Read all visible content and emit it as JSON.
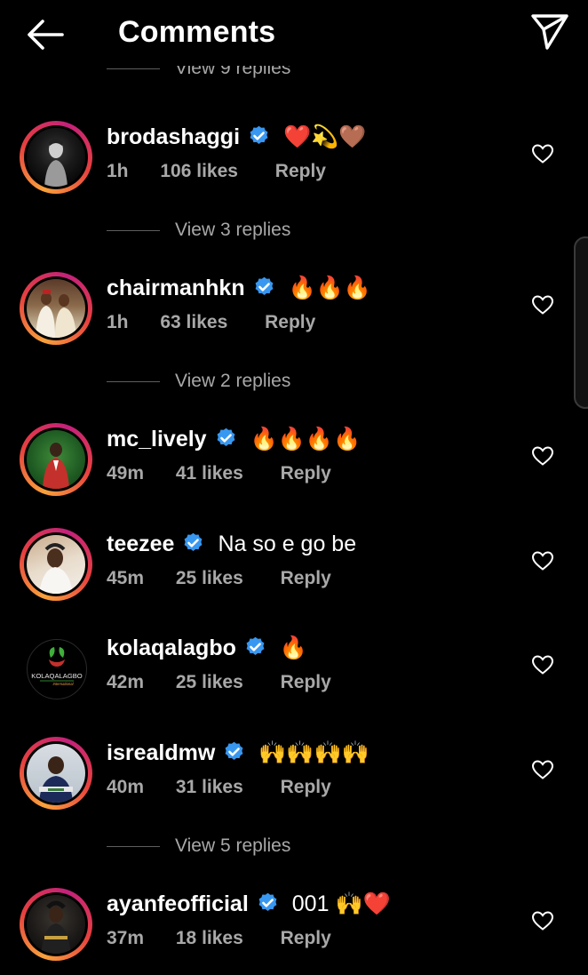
{
  "header": {
    "title": "Comments",
    "back_icon": "arrow-left-icon",
    "send_icon": "paper-plane-icon"
  },
  "top_view_replies": "View 9 replies",
  "comments": [
    {
      "username": "brodashaggi",
      "verified": true,
      "text": "❤️💫🤎",
      "time": "1h",
      "likes": "106 likes",
      "reply": "Reply",
      "avatar_ring": true,
      "view_replies": "View 3 replies"
    },
    {
      "username": "chairmanhkn",
      "verified": true,
      "text": "🔥🔥🔥",
      "time": "1h",
      "likes": "63 likes",
      "reply": "Reply",
      "avatar_ring": true,
      "view_replies": "View 2 replies"
    },
    {
      "username": "mc_lively",
      "verified": true,
      "text": "🔥🔥🔥🔥",
      "time": "49m",
      "likes": "41 likes",
      "reply": "Reply",
      "avatar_ring": true
    },
    {
      "username": "teezee",
      "verified": true,
      "text": "Na so e go be",
      "time": "45m",
      "likes": "25 likes",
      "reply": "Reply",
      "avatar_ring": true
    },
    {
      "username": "kolaqalagbo",
      "verified": true,
      "text": "🔥",
      "time": "42m",
      "likes": "25 likes",
      "reply": "Reply",
      "avatar_ring": false,
      "avatar_logo_text": "KOLAQALAGBO",
      "avatar_logo_subtext": "International"
    },
    {
      "username": "isrealdmw",
      "verified": true,
      "text": "🙌🙌🙌🙌",
      "time": "40m",
      "likes": "31 likes",
      "reply": "Reply",
      "avatar_ring": true,
      "view_replies": "View 5 replies"
    },
    {
      "username": "ayanfeofficial",
      "verified": true,
      "text": "001 🙌❤️",
      "time": "37m",
      "likes": "18 likes",
      "reply": "Reply",
      "avatar_ring": true
    }
  ],
  "colors": {
    "background": "#000000",
    "text_primary": "#ffffff",
    "text_secondary": "#a8a8a8",
    "verified_blue": "#3897f0",
    "story_ring_start": "#f9a13c",
    "story_ring_end": "#c3217b"
  }
}
